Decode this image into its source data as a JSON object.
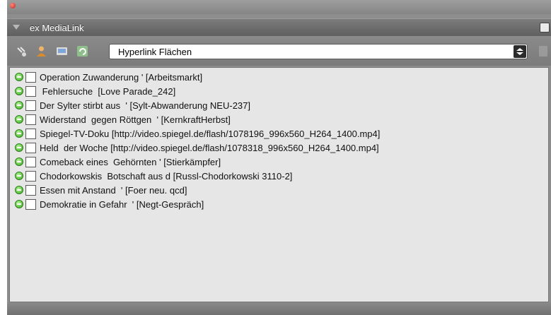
{
  "panel": {
    "title": "ex MediaLink"
  },
  "toolbar": {
    "icons": [
      "link-tool-icon",
      "person-icon",
      "screen-icon",
      "refresh-icon"
    ],
    "dropdown_value": "Hyperlink Flächen"
  },
  "items": [
    {
      "label": "Operation Zuwanderung ' [Arbeitsmarkt]"
    },
    {
      "label": " Fehlersuche  [Love Parade_242]"
    },
    {
      "label": "Der Sylter stirbt aus  ' [Sylt-Abwanderung NEU-237]"
    },
    {
      "label": "Widerstand  gegen Röttgen  ' [KernkraftHerbst]"
    },
    {
      "label": "Spiegel-TV-Doku [http://video.spiegel.de/flash/1078196_996x560_H264_1400.mp4]"
    },
    {
      "label": "Held  der Woche [http://video.spiegel.de/flash/1078318_996x560_H264_1400.mp4]"
    },
    {
      "label": "Comeback eines  Gehörnten ' [Stierkämpfer]"
    },
    {
      "label": "Chodorkowskis  Botschaft aus d [Russl-Chodorkowski 3110-2]"
    },
    {
      "label": "Essen mit Anstand  ' [Foer neu. qcd]"
    },
    {
      "label": "Demokratie in Gefahr  ' [Negt-Gespräch]"
    }
  ]
}
